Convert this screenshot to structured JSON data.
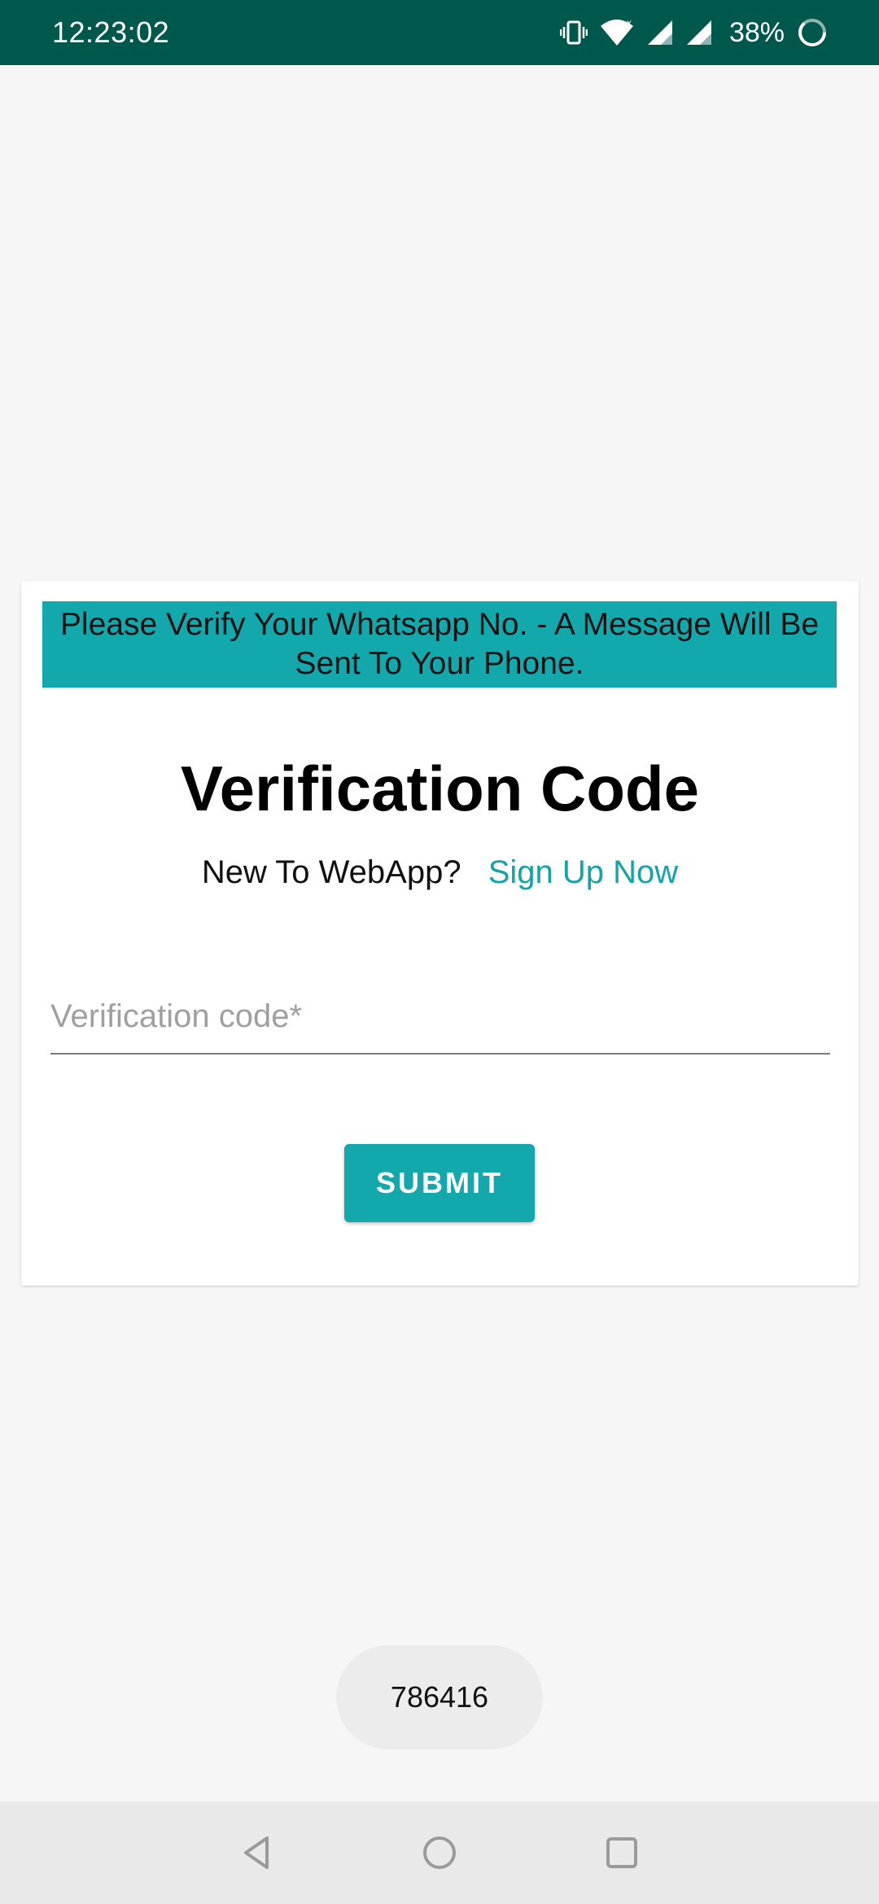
{
  "status_bar": {
    "time": "12:23:02",
    "battery": "38%",
    "icons": [
      "vibrate-icon",
      "wifi-icon",
      "signal-icon",
      "signal-icon",
      "battery-saver-icon"
    ],
    "color": "#00574b"
  },
  "card": {
    "banner_text": "Please Verify Your Whatsapp No. - A Message Will Be Sent To Your Phone.",
    "title": "Verification Code",
    "signup_prompt": "New To WebApp?",
    "signup_link": "Sign Up Now",
    "code_field": {
      "placeholder": "Verification code*",
      "value": ""
    },
    "submit_label": "SUBMIT"
  },
  "toast": {
    "text": "786416"
  },
  "nav_bar": {
    "buttons": [
      "back-icon",
      "home-icon",
      "recents-icon"
    ]
  },
  "colors": {
    "accent": "#13a8ac",
    "background": "#f6f6f6"
  }
}
